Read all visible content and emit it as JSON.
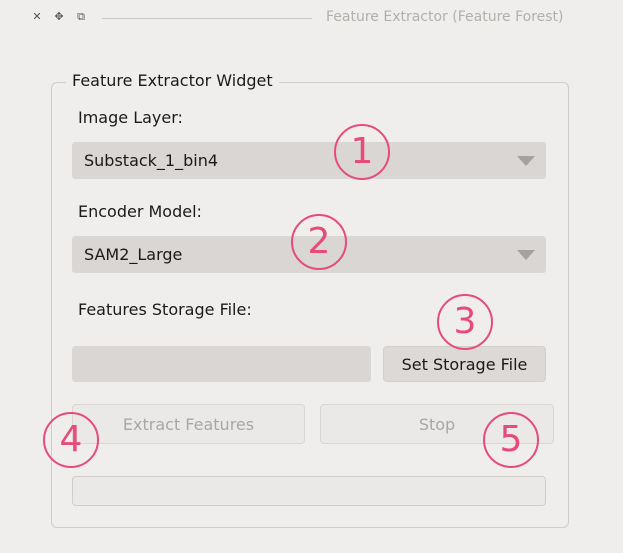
{
  "window": {
    "title": "Feature Extractor (Feature Forest)",
    "close_glyph": "✕",
    "float_glyph": "✥",
    "restore_glyph": "⧉"
  },
  "widget": {
    "group_title": "Feature Extractor Widget",
    "image_layer": {
      "label": "Image Layer:",
      "selected": "Substack_1_bin4"
    },
    "encoder_model": {
      "label": "Encoder Model:",
      "selected": "SAM2_Large"
    },
    "storage": {
      "label": "Features Storage File:",
      "path_value": "",
      "button_label": "Set Storage File"
    },
    "extract_button_label": "Extract Features",
    "stop_button_label": "Stop",
    "progress": {
      "value_percent": 0
    }
  },
  "callouts": [
    "1",
    "2",
    "3",
    "4",
    "5"
  ],
  "colors": {
    "callout": "#e64b7a",
    "background": "#f0eeec",
    "field": "#d9d6d3"
  }
}
